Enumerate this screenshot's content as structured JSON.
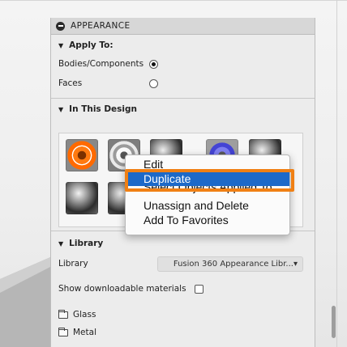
{
  "panel": {
    "title": "APPEARANCE",
    "apply_to": {
      "heading": "Apply To:",
      "options": [
        {
          "label": "Bodies/Components",
          "selected": true
        },
        {
          "label": "Faces",
          "selected": false
        }
      ]
    },
    "in_this_design": {
      "heading": "In This Design",
      "swatches": [
        {
          "icon": "orange-ring-swatch",
          "material": "orange"
        },
        {
          "icon": "chrome-ring-swatch",
          "material": "chrome"
        },
        {
          "icon": "metal-sphere-swatch",
          "material": "metal"
        },
        {
          "icon": "blue-ring-swatch",
          "material": "blue"
        },
        {
          "icon": "metal-sphere-swatch",
          "material": "metal"
        },
        {
          "icon": "metal-sphere-swatch",
          "material": "metal"
        },
        {
          "icon": "metal-sphere-swatch",
          "material": "metal"
        }
      ]
    },
    "library": {
      "heading": "Library",
      "label": "Library",
      "selected": "Fusion 360 Appearance Libr...▾",
      "show_downloadable": "Show downloadable materials",
      "show_downloadable_checked": false,
      "folders": [
        "Glass",
        "Metal"
      ]
    }
  },
  "context_menu": {
    "items": [
      "Edit",
      "Duplicate",
      "Select Objects Applied To",
      "Unassign and Delete",
      "Add To Favorites"
    ],
    "highlighted": "Duplicate",
    "highlight_color": "#1d69c8",
    "callout_color": "#f08014"
  },
  "icons": {
    "collapse": "minus-circle-icon",
    "expand": "triangle-down-icon",
    "folder": "folder-icon"
  }
}
